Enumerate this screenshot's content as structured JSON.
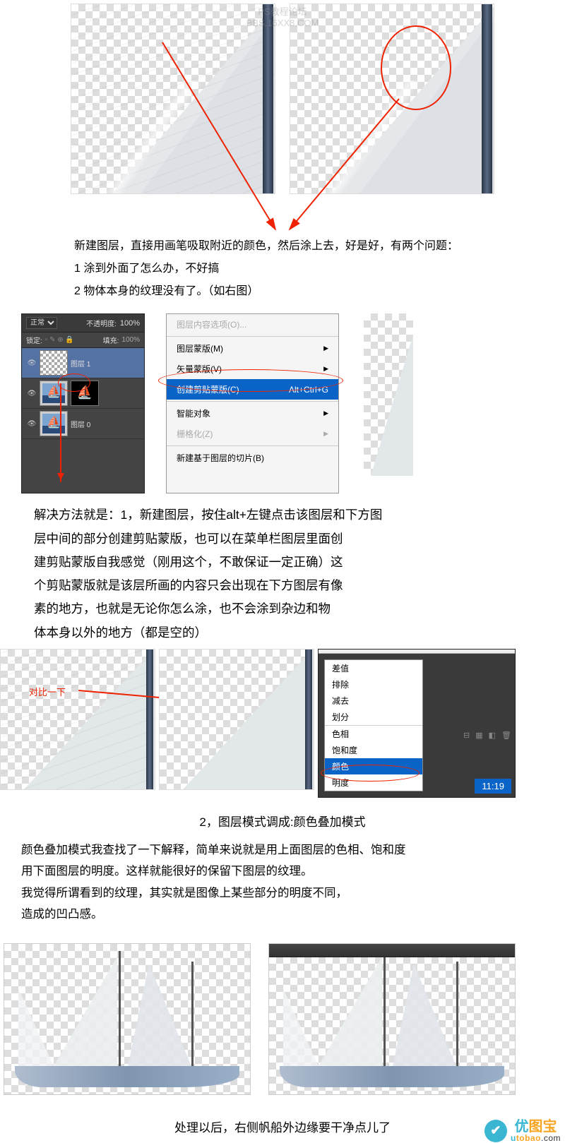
{
  "watermark": {
    "line1": "PS教程论坛",
    "line2": "BBS.16XX8.COM"
  },
  "text1": {
    "p1": "新建图层，直接用画笔吸取附近的颜色，然后涂上去，好是好，有两个问题：",
    "p2": "1 涂到外面了怎么办，不好搞",
    "p3": "2 物体本身的纹理没有了。（如右图）"
  },
  "layersPanel": {
    "mode": "正常",
    "opacityLabel": "不透明度:",
    "opacityVal": "100%",
    "lockLabel": "锁定:",
    "fillLabel": "填充:",
    "fillVal": "100%",
    "layer1": "图层 1",
    "layer0": "图层 0"
  },
  "contextMenu": {
    "item1": "图层内容选项(O)...",
    "item2": "图层蒙版(M)",
    "item3": "矢量蒙版(V)",
    "item4": "创建剪贴蒙版(C)",
    "item4_shortcut": "Alt+Ctrl+G",
    "item5": "智能对象",
    "item6": "栅格化(Z)",
    "item7": "新建基于图层的切片(B)"
  },
  "text2": {
    "p1": "解决方法就是：1，新建图层，按住alt+左键点击该图层和下方图",
    "p2": "层中间的部分创建剪贴蒙版，也可以在菜单栏图层里面创",
    "p3": "建剪贴蒙版自我感觉（刚用这个，不敢保证一定正确）这",
    "p4": "个剪贴蒙版就是该层所画的内容只会出现在下方图层有像",
    "p5": "素的地方，也就是无论你怎么涂，也不会涂到杂边和物",
    "p6": "体本身以外的地方（都是空的）"
  },
  "compareAnnotation": "对比一下",
  "blendModes": {
    "item1": "差值",
    "item2": "排除",
    "item3": "减去",
    "item4": "划分",
    "item5": "色相",
    "item6": "饱和度",
    "item7": "颜色",
    "item8": "明度",
    "time": "11:19"
  },
  "centered": "2，图层模式调成:颜色叠加模式",
  "text3": {
    "p1": "颜色叠加模式我查找了一下解释，简单来说就是用上面图层的色相、饱和度",
    "p2": "用下面图层的明度。这样就能很好的保留下图层的纹理。",
    "p3": "我觉得所谓看到的纹理，其实就是图像上某些部分的明度不同，",
    "p4": "造成的凹凸感。"
  },
  "logo": {
    "cn1": "优",
    "cn2": "图宝",
    "url_u": "u",
    "url_tobao": "tobao",
    "url_com": ".com"
  },
  "bottomCaption": "处理以后，右侧帆船外边缘要干净点儿了"
}
